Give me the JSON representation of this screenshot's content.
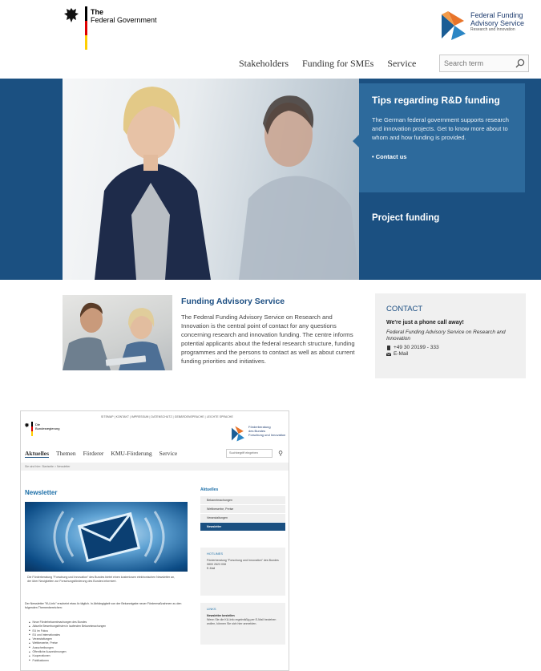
{
  "header": {
    "gov_logo": {
      "line1": "The",
      "line2": "Federal Government"
    },
    "ffas_logo": {
      "line1": "Federal Funding",
      "line2": "Advisory Service",
      "line3": "Research and Innovation"
    }
  },
  "nav": {
    "items": [
      "Stakeholders",
      "Funding for SMEs",
      "Service"
    ],
    "search_placeholder": "Search term"
  },
  "hero": {
    "tips_title": "Tips regarding R&D funding",
    "tips_body": "The German federal government supports research and innovation projects. Get to know more about to whom and how funding is provided.",
    "tips_link": "• Contact us",
    "project_funding": "Project funding"
  },
  "fas": {
    "title": "Funding Advisory Service",
    "body": "The Federal Funding Advisory Service on Research and Innovation is the central point of contact for any questions concerning research and innovation funding. The centre informs potential applicants about the federal research structure, funding programmes and the persons to contact as well as about current funding priorities and initiatives."
  },
  "contact": {
    "title": "CONTACT",
    "subtitle": "We're just a phone call away!",
    "org": "Federal Funding Advisory Service on Research and Innovation",
    "phone": "+49 30 20199 - 333",
    "email": "E-Mail"
  },
  "mock": {
    "topbar": "SITEMAP  |  KONTAKT  |  IMPRESSUM  |  DATENSCHUTZ  |  GEBÄRDENSPRACHE  |  LEICHTE SPRACHE",
    "gov": "Die\nBundesregierung",
    "logo_text": "Förderberatung\ndes Bundes\nForschung und Innovation",
    "nav": [
      "Aktuelles",
      "Themen",
      "Förderer",
      "KMU-Förderung",
      "Service"
    ],
    "search_placeholder": "Suchbegriff eingeben",
    "breadcrumb": "Sie sind hier:  Startseite  >  Newsletter",
    "heading": "Newsletter",
    "caption": "Die Förderberatung \"Forschung und Innovation\" des Bundes bietet einen kostenlosen elektronischen Newsletter an, der über Neuigkeiten zur Forschungsförderung des Bundes informiert.",
    "para": "Der Newsletter \"KU-Info\" erscheint etwa 4x täglich. In Abhängigkeit von der Bekanntgabe neuer Fördermaßnahmen zu den folgenden Themenbereichen:",
    "list": [
      "Neue Förderbekanntmachungen des Bundes",
      "Aktuelle Bewerbungsfristen in laufenden Bekanntmachungen",
      "EU im Fokus",
      "EU und Internationales",
      "Veranstaltungen",
      "Wettbewerbe, Preise",
      "Ausschreibungen",
      "Öffentliche Auszeichnungen",
      "Kooperationen",
      "Publikationen"
    ],
    "side_heading": "Aktuelles",
    "side_items": [
      "Bekanntmachungen",
      "Wettbewerbe, Preise",
      "Veranstaltungen",
      "Newsletter"
    ],
    "hotline_title": "HOTLINES",
    "hotline_body": "Förderberatung \"Forschung und Innovation\" des Bundes",
    "hotline_phone": "0800 2623 008",
    "hotline_email": "E-Mail",
    "links_title": "LINKS",
    "links_item": "Newsletter bestellen",
    "links_body": "Wenn Sie die KU-Info regelmäßig per E-Mail beziehen wollen, können Sie sich hier anmelden."
  }
}
